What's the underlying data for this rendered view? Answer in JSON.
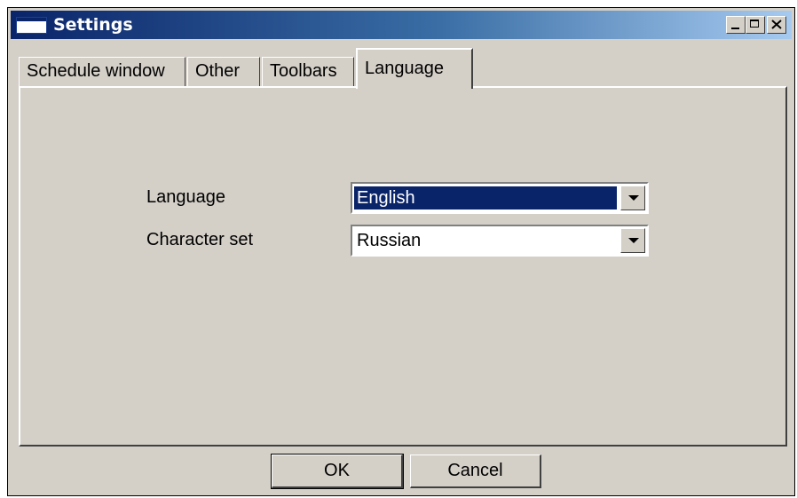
{
  "window": {
    "title": "Settings"
  },
  "tabs": [
    {
      "label": "Schedule window"
    },
    {
      "label": "Other"
    },
    {
      "label": "Toolbars"
    },
    {
      "label": "Language"
    }
  ],
  "active_tab": "Language",
  "form": {
    "language_label": "Language",
    "language_value": "English",
    "charset_label": "Character set",
    "charset_value": "Russian"
  },
  "buttons": {
    "ok": "OK",
    "cancel": "Cancel"
  },
  "colors": {
    "titlebar_start": "#0a246a",
    "titlebar_end": "#a6caf0",
    "window_face": "#d4d0c8",
    "selection": "#0a246a"
  }
}
